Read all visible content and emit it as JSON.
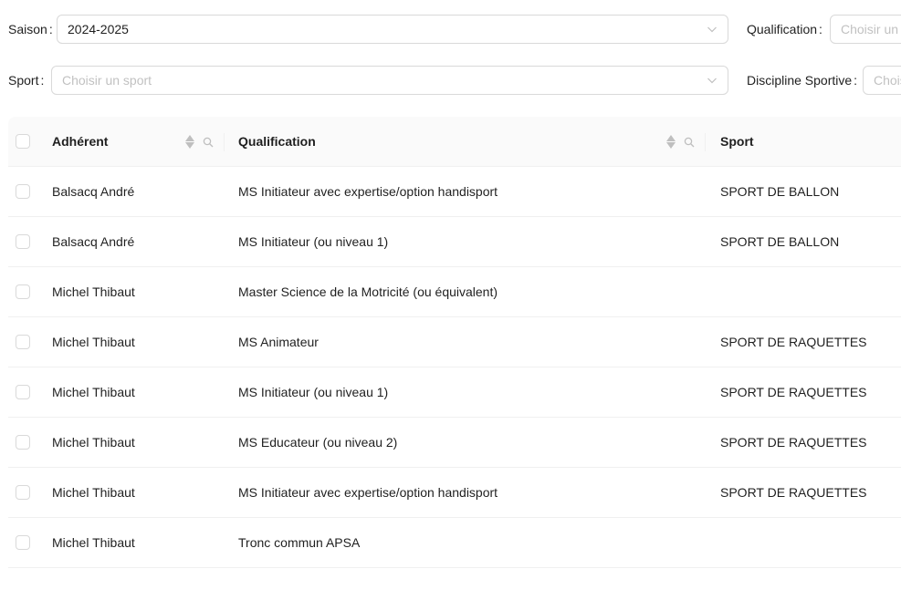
{
  "filters": {
    "saison": {
      "label": "Saison",
      "value": "2024-2025"
    },
    "qualification": {
      "label": "Qualification",
      "placeholder": "Choisir un"
    },
    "sport": {
      "label": "Sport",
      "placeholder": "Choisir un sport"
    },
    "discipline": {
      "label": "Discipline Sportive",
      "placeholder": "Chois"
    },
    "colon": ":"
  },
  "table": {
    "columns": {
      "adherent": "Adhérent",
      "qualification": "Qualification",
      "sport": "Sport"
    },
    "rows": [
      {
        "adherent": "Balsacq André",
        "qualification": "MS Initiateur avec expertise/option handisport",
        "sport": "SPORT DE BALLON"
      },
      {
        "adherent": "Balsacq André",
        "qualification": "MS Initiateur (ou niveau 1)",
        "sport": "SPORT DE BALLON"
      },
      {
        "adherent": "Michel Thibaut",
        "qualification": "Master Science de la Motricité (ou équivalent)",
        "sport": ""
      },
      {
        "adherent": "Michel Thibaut",
        "qualification": "MS Animateur",
        "sport": "SPORT DE RAQUETTES"
      },
      {
        "adherent": "Michel Thibaut",
        "qualification": "MS Initiateur (ou niveau 1)",
        "sport": "SPORT DE RAQUETTES"
      },
      {
        "adherent": "Michel Thibaut",
        "qualification": "MS Educateur (ou niveau 2)",
        "sport": "SPORT DE RAQUETTES"
      },
      {
        "adherent": "Michel Thibaut",
        "qualification": "MS Initiateur avec expertise/option handisport",
        "sport": "SPORT DE RAQUETTES"
      },
      {
        "adherent": "Michel Thibaut",
        "qualification": "Tronc commun APSA",
        "sport": ""
      }
    ]
  },
  "icons": {
    "select_arrow": "chevron-down-icon",
    "sort": "sort-icon",
    "filter": "search-icon"
  },
  "colors": {
    "border": "#d9d9d9",
    "header_bg": "#fafafa",
    "row_divider": "#f0f0f0",
    "placeholder": "#bfbfbf"
  }
}
